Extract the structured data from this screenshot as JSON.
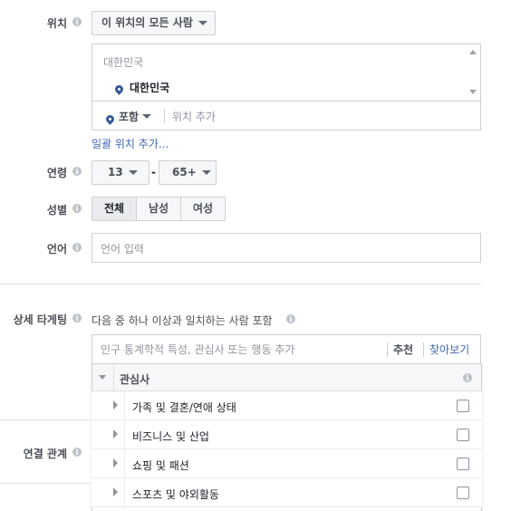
{
  "location": {
    "label": "위치",
    "dropdown": "이 위치의 모든 사람",
    "list_header": "대한민국",
    "selected_item": "대한민국",
    "include_label": "포함",
    "add_placeholder": "위치 추가",
    "bulk_link": "일괄 위치 추가..."
  },
  "age": {
    "label": "연령",
    "min": "13",
    "dash": "-",
    "max": "65+"
  },
  "gender": {
    "label": "성별",
    "options": [
      "전체",
      "남성",
      "여성"
    ],
    "selected": "전체"
  },
  "language": {
    "label": "언어",
    "placeholder": "언어 입력"
  },
  "detailed_targeting": {
    "label": "상세 타게팅",
    "description": "다음 중 하나 이상과 일치하는 사람 포함",
    "placeholder": "인구 통계학적 특성, 관심사 또는 행동 추가",
    "suggestions_label": "추천",
    "browse_label": "찾아보기",
    "category": "관심사",
    "items": [
      "가족 및 결혼/연애 상태",
      "비즈니스 및 산업",
      "쇼핑 및 패션",
      "스포츠 및 야외활동"
    ]
  },
  "connections": {
    "label": "연결 관계"
  },
  "colors": {
    "link": "#4267b2",
    "pin": "#365899",
    "border": "#ccd0d5"
  },
  "icons": [
    "info-icon",
    "location-pin-icon",
    "chevron-down-icon",
    "expand-arrow-icon",
    "checkbox"
  ]
}
